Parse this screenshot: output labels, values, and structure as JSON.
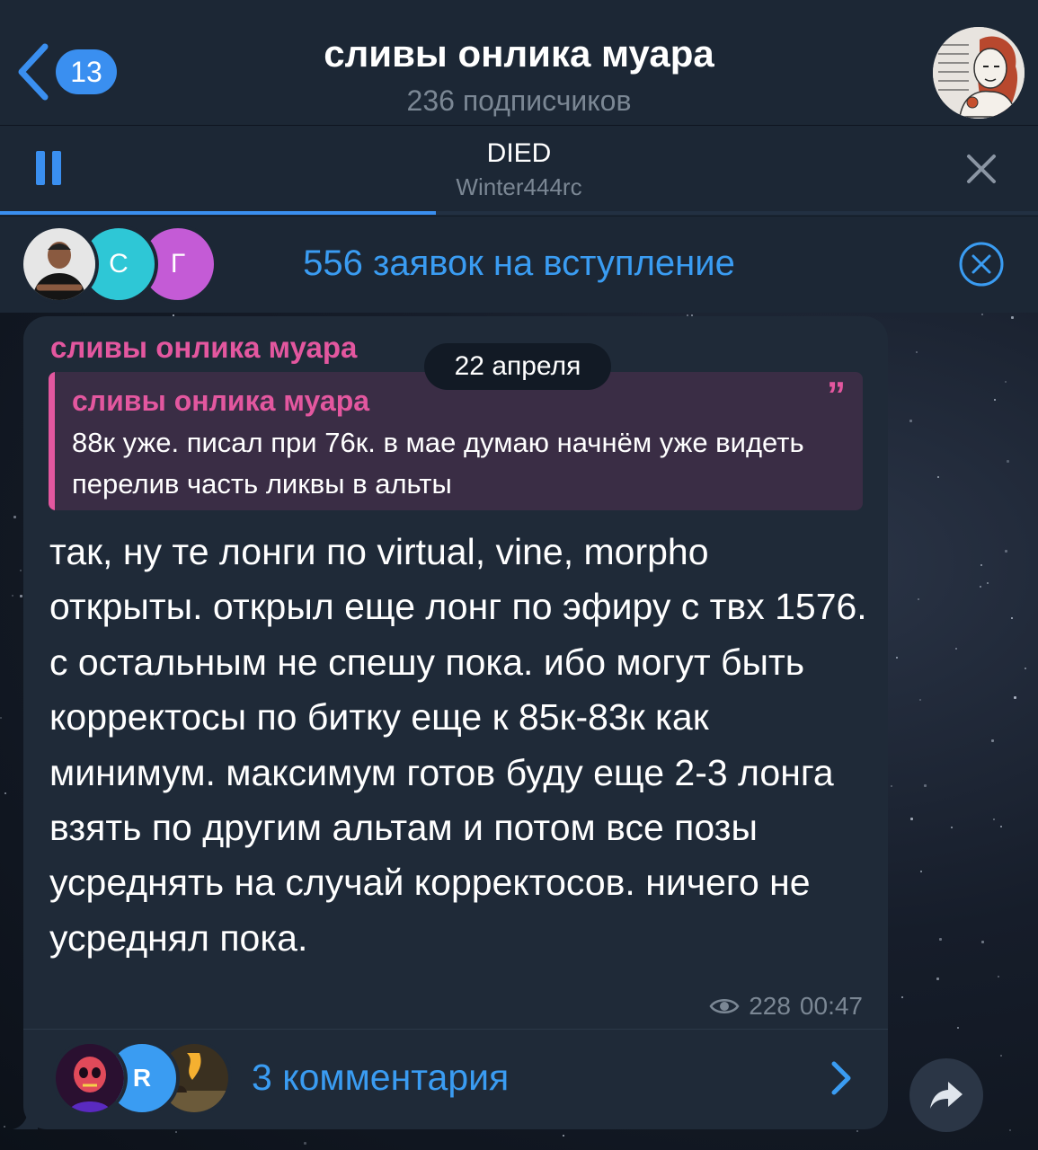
{
  "header": {
    "back_badge": "13",
    "channel_title": "сливы онлика муара",
    "subscribers": "236 подписчиков"
  },
  "audio": {
    "title": "DIED",
    "artist": "Winter444rc",
    "progress": 0.42
  },
  "join_requests": {
    "avatars": [
      {
        "initial": "",
        "color": "#6d5a4a"
      },
      {
        "initial": "С",
        "color": "#2ec7d6"
      },
      {
        "initial": "Г",
        "color": "#c45bd6"
      }
    ],
    "label": "556 заявок на вступление"
  },
  "message": {
    "sender": "сливы онлика муара",
    "date": "22 апреля",
    "quote": {
      "author": "сливы онлика муара",
      "text": "88к уже. писал при 76к. в мае думаю начнём уже видеть перелив часть ликвы в альты"
    },
    "text": "так, ну те лонги по virtual, vine, morpho открыты. открыл еще лонг по эфиру с твх 1576. с остальным не спешу пока. ибо могут быть корректосы по битку еще к 85к-83к как минимум. максимум готов буду еще 2-3 лонга взять по другим альтам и потом все позы усреднять на случай корректосов. ничего не усреднял пока.",
    "views": "228",
    "time": "00:47",
    "comments": {
      "label": "3 комментария",
      "avatars": [
        {
          "initial": "",
          "color": "#3b1f3a"
        },
        {
          "initial": "R",
          "color": "#3a9cf2"
        },
        {
          "initial": "",
          "color": "#5a4a2e"
        }
      ]
    }
  },
  "colors": {
    "accent": "#3a9cf2",
    "sender": "#e3579f",
    "bubble": "#1f2a38",
    "header": "#1c2735"
  }
}
